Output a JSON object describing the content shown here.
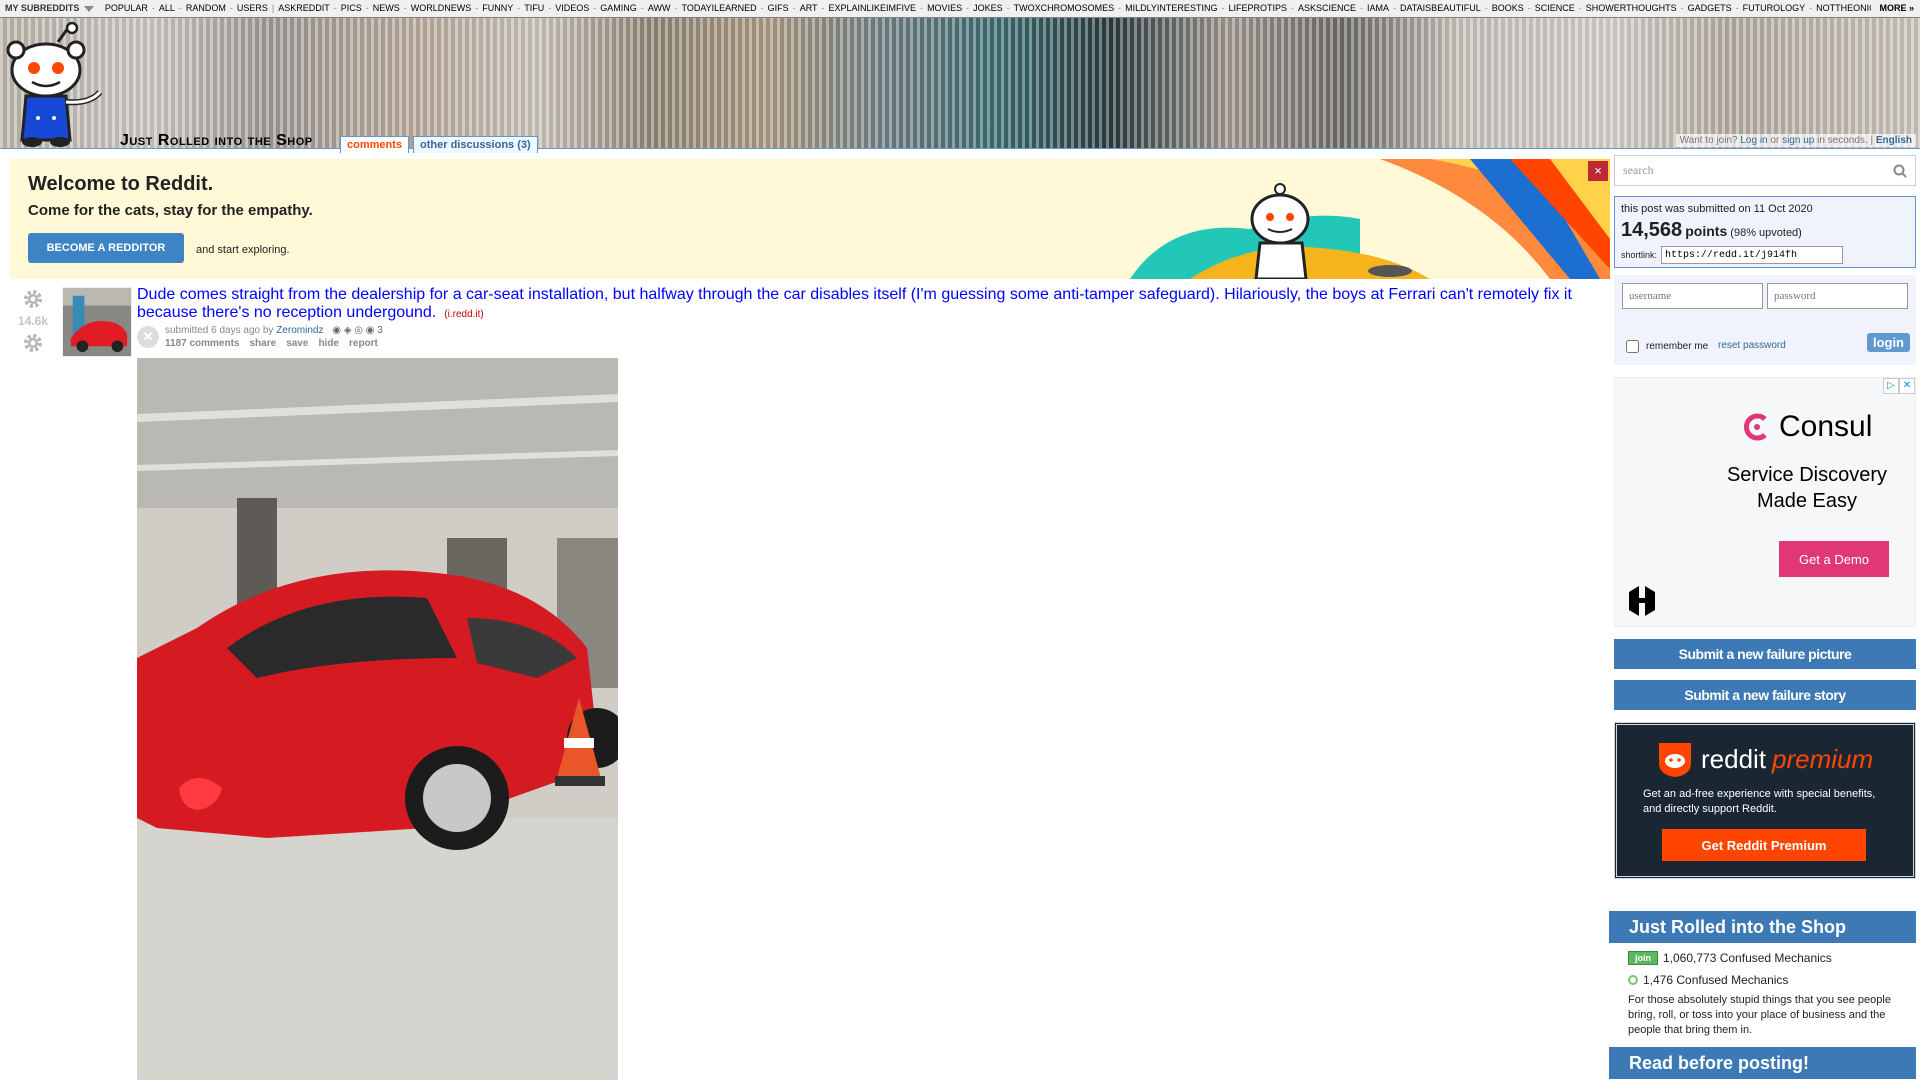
{
  "srbar": {
    "my_subreddits": "MY SUBREDDITS",
    "links": [
      "POPULAR",
      "ALL",
      "RANDOM",
      "USERS",
      "ASKREDDIT",
      "PICS",
      "NEWS",
      "WORLDNEWS",
      "FUNNY",
      "TIFU",
      "VIDEOS",
      "GAMING",
      "AWW",
      "TODAYILEARNED",
      "GIFS",
      "ART",
      "EXPLAINLIKEIMFIVE",
      "MOVIES",
      "JOKES",
      "TWOXCHROMOSOMES",
      "MILDLYINTERESTING",
      "LIFEPROTIPS",
      "ASKSCIENCE",
      "IAMA",
      "DATAISBEAUTIFUL",
      "BOOKS",
      "SCIENCE",
      "SHOWERTHOUGHTS",
      "GADGETS",
      "FUTUROLOGY",
      "NOTTHEONION",
      "N"
    ],
    "more": "MORE »"
  },
  "header": {
    "subreddit_title": "Just Rolled into the Shop",
    "tabs": [
      {
        "label": "comments",
        "selected": true
      },
      {
        "label": "other discussions (3)",
        "selected": false
      }
    ],
    "userbar": {
      "prefix": "Want to join?",
      "login": "Log in",
      "or": "or",
      "signup": "sign up",
      "suffix": "in seconds.",
      "sep": "|",
      "language": "English"
    }
  },
  "welcome": {
    "title": "Welcome to Reddit.",
    "subtitle": "Come for the cats, stay for the empathy.",
    "button": "BECOME A REDDITOR",
    "tail": "and start exploring.",
    "close": "×"
  },
  "post": {
    "score": "14.6k",
    "title": "Dude comes straight from the dealership for a car-seat installation, but halfway through the car disables itself (I'm guessing some anti-tamper safeguard). Hilariously, the boys at Ferrari can't remotely fix it because there's no reception undergound.",
    "domain": "(i.redd.it)",
    "submitted_prefix": "submitted",
    "submitted_ago": "6 days ago",
    "by": "by",
    "author": "Zeromindz",
    "award_count": "3",
    "buttons": [
      "1187 comments",
      "share",
      "save",
      "hide",
      "report"
    ]
  },
  "sidebar": {
    "search_placeholder": "search",
    "linkinfo": {
      "date_text": "this post was submitted on 11 Oct 2020",
      "points": "14,568",
      "points_label": "points",
      "upvoted": "(98% upvoted)",
      "shortlink_label": "shortlink:",
      "shortlink": "https://redd.it/j914fh"
    },
    "login": {
      "username_placeholder": "username",
      "password_placeholder": "password",
      "remember": "remember me",
      "reset": "reset password",
      "button": "login"
    },
    "ad": {
      "brand": "Consul",
      "tagline1": "Service Discovery",
      "tagline2": "Made Easy",
      "cta": "Get a Demo",
      "accent": "#e03875"
    },
    "submit_picture": "Submit a new failure picture",
    "submit_story": "Submit a new failure story",
    "premium": {
      "brand": "reddit",
      "brand2": "premium",
      "text": "Get an ad-free experience with special benefits, and directly support Reddit.",
      "button": "Get Reddit Premium"
    },
    "subreddit_box": {
      "title": "Just Rolled into the Shop",
      "join": "join",
      "subscribers": "1,060,773 Confused Mechanics",
      "online": "1,476 Confused Mechanics",
      "description": "For those absolutely stupid things that you see people bring, roll, or toss into your place of business and the people that bring them in."
    },
    "rules_title": "Read before posting!"
  }
}
